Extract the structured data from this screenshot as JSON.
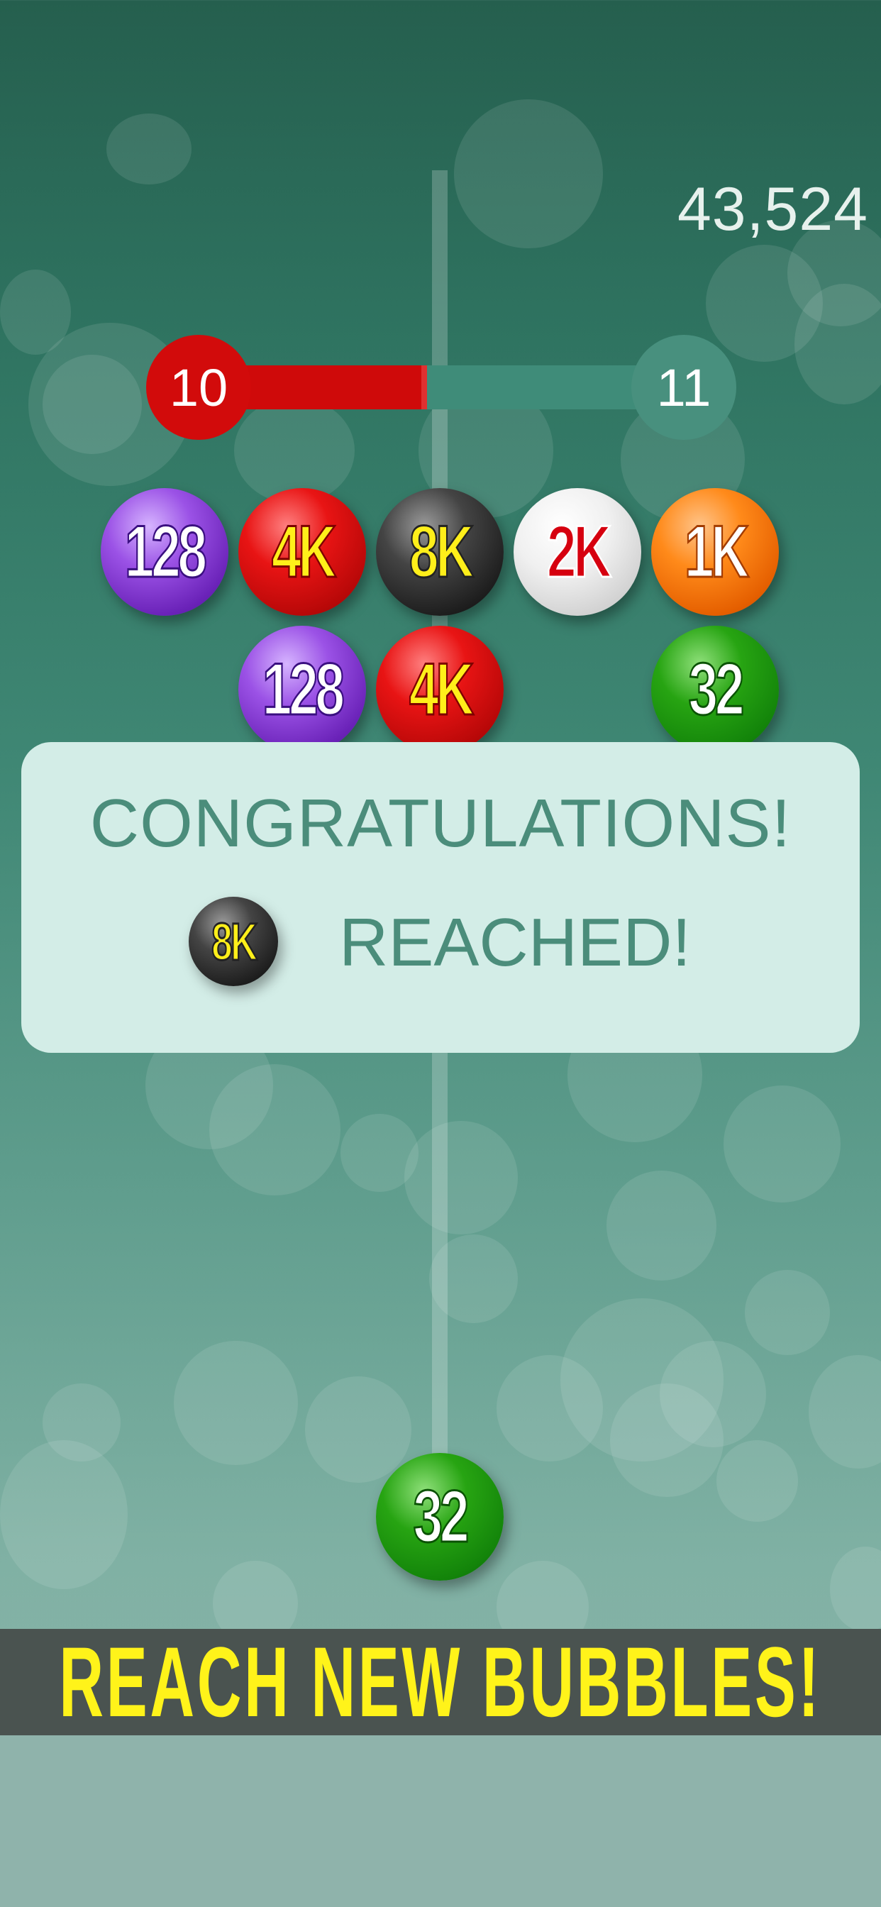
{
  "score": "43,524",
  "level": {
    "current": "10",
    "next": "11",
    "progress": 0.46
  },
  "grid": {
    "row1": [
      {
        "label": "128",
        "color": "purple"
      },
      {
        "label": "4K",
        "color": "red"
      },
      {
        "label": "8K",
        "color": "black"
      },
      {
        "label": "2K",
        "color": "white"
      },
      {
        "label": "1K",
        "color": "orange"
      }
    ],
    "row2": [
      {
        "label": "128",
        "color": "purple"
      },
      {
        "label": "4K",
        "color": "red"
      },
      {
        "label": "32",
        "color": "green"
      }
    ]
  },
  "dialog": {
    "title": "CONGRATULATIONS!",
    "bubble": {
      "label": "8K",
      "color": "black"
    },
    "reached": "REACHED!"
  },
  "shooter": {
    "label": "32",
    "color": "green"
  },
  "banner": "REACH NEW BUBBLES!"
}
